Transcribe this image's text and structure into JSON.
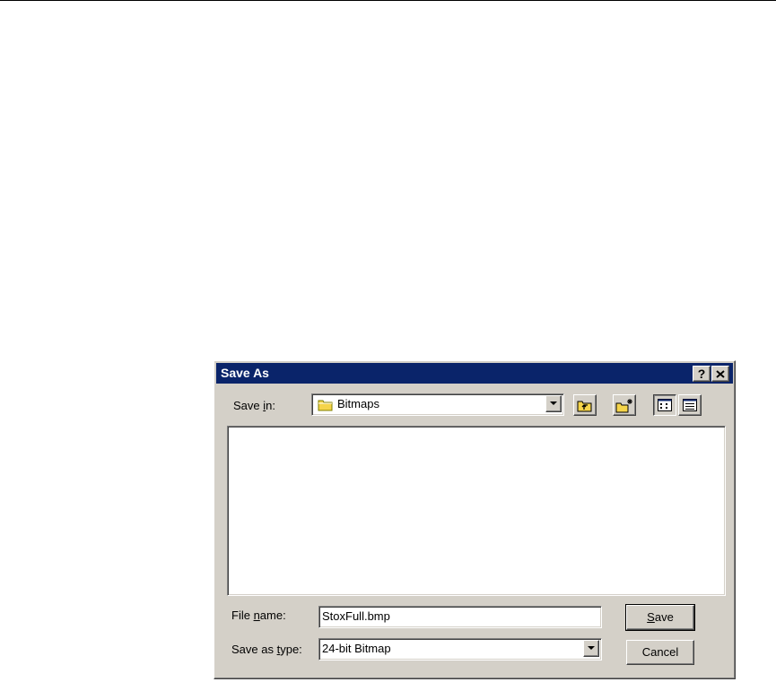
{
  "dialog": {
    "title": "Save As",
    "help_label": "?",
    "save_in": {
      "label_pre": "Save ",
      "label_key": "i",
      "label_post": "n:",
      "value": "Bitmaps",
      "icon": "folder-icon"
    },
    "toolbar": {
      "up_icon": "up-one-level-icon",
      "new_folder_icon": "new-folder-icon",
      "list_view_icon": "list-view-icon",
      "details_view_icon": "details-view-icon"
    },
    "file_name": {
      "label_pre": "File ",
      "label_key": "n",
      "label_post": "ame:",
      "value": "StoxFull.bmp"
    },
    "save_as_type": {
      "label_pre": "Save as ",
      "label_key": "t",
      "label_post": "ype:",
      "value": "24-bit Bitmap"
    },
    "buttons": {
      "save_key": "S",
      "save_rest": "ave",
      "cancel": "Cancel"
    }
  },
  "colors": {
    "face": "#d4d0c8",
    "titlebar": "#0a246a",
    "folder": "#f5d44a"
  }
}
